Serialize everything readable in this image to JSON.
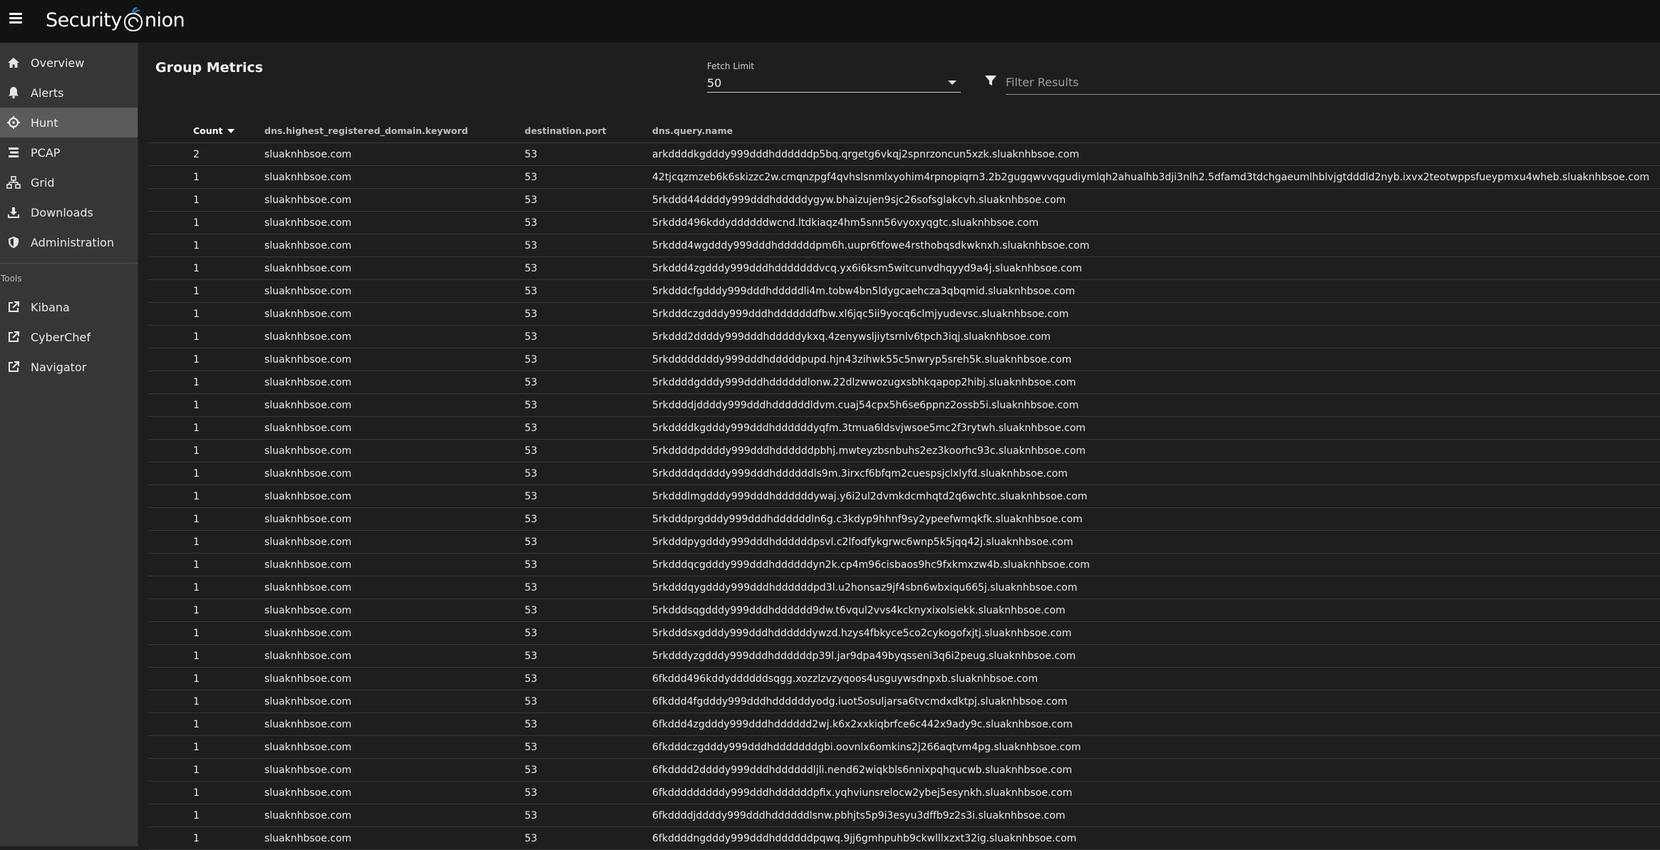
{
  "header": {
    "logo_text_left": "Security",
    "logo_text_right": "nion",
    "colors": {
      "topbar": "#121212",
      "logo_accent": "#2f86c7"
    }
  },
  "sidebar": {
    "items": [
      {
        "label": "Overview",
        "icon": "home-icon"
      },
      {
        "label": "Alerts",
        "icon": "bell-icon"
      },
      {
        "label": "Hunt",
        "icon": "crosshairs-icon",
        "active": true
      },
      {
        "label": "PCAP",
        "icon": "pcap-list-icon"
      },
      {
        "label": "Grid",
        "icon": "grid-network-icon"
      },
      {
        "label": "Downloads",
        "icon": "download-icon"
      },
      {
        "label": "Administration",
        "icon": "shield-icon"
      }
    ],
    "tools_heading": "Tools",
    "tools": [
      {
        "label": "Kibana",
        "icon": "external-link-icon"
      },
      {
        "label": "CyberChef",
        "icon": "external-link-icon"
      },
      {
        "label": "Navigator",
        "icon": "external-link-icon"
      }
    ]
  },
  "main": {
    "title": "Group Metrics",
    "fetch_limit": {
      "label": "Fetch Limit",
      "value": "50"
    },
    "filter": {
      "placeholder": "Filter Results",
      "value": ""
    },
    "table": {
      "columns": [
        "Count",
        "dns.highest_registered_domain.keyword",
        "destination.port",
        "dns.query.name"
      ],
      "rows": [
        [
          "2",
          "sluaknhbsoe.com",
          "53",
          "arkddddkgdddy999dddhddddddp5bq.qrgetg6vkqj2spnrzoncun5xzk.sluaknhbsoe.com"
        ],
        [
          "1",
          "sluaknhbsoe.com",
          "53",
          "42tjcqzmzeb6k6skizzc2w.cmqnzpgf4qvhslsnmlxyohim4rpnopiqrn3.2b2gugqwvvqgudiymlqh2ahualhb3dji3nlh2.5dfamd3tdchgaeumlhblvjgtdddld2nyb.ixvx2teotwppsfueypmxu4wheb.sluaknhbsoe.com"
        ],
        [
          "1",
          "sluaknhbsoe.com",
          "53",
          "5rkddd44ddddy999dddhdddddygyw.bhaizujen9sjc26sofsglakcvh.sluaknhbsoe.com"
        ],
        [
          "1",
          "sluaknhbsoe.com",
          "53",
          "5rkddd496kddyddddddwcnd.ltdkiaqz4hm5snn56vyoxyqgtc.sluaknhbsoe.com"
        ],
        [
          "1",
          "sluaknhbsoe.com",
          "53",
          "5rkddd4wgdddy999dddhddddddpm6h.uupr6tfowe4rsthobqsdkwknxh.sluaknhbsoe.com"
        ],
        [
          "1",
          "sluaknhbsoe.com",
          "53",
          "5rkddd4zgdddy999dddhdddddddvcq.yx6i6ksm5witcunvdhqyyd9a4j.sluaknhbsoe.com"
        ],
        [
          "1",
          "sluaknhbsoe.com",
          "53",
          "5rkdddcfgdddy999dddhdddddli4m.tobw4bn5ldygcaehcza3qbqmid.sluaknhbsoe.com"
        ],
        [
          "1",
          "sluaknhbsoe.com",
          "53",
          "5rkdddczgdddy999dddhdddddddfbw.xl6jqc5ii9yocq6clmjyudevsc.sluaknhbsoe.com"
        ],
        [
          "1",
          "sluaknhbsoe.com",
          "53",
          "5rkddd2ddddy999dddhdddddykxq.4zenywsljiytsrnlv6tpch3iqj.sluaknhbsoe.com"
        ],
        [
          "1",
          "sluaknhbsoe.com",
          "53",
          "5rkddddddddy999dddhdddddpupd.hjn43zihwk55c5nwryp5sreh5k.sluaknhbsoe.com"
        ],
        [
          "1",
          "sluaknhbsoe.com",
          "53",
          "5rkddddgdddy999dddhddddddlonw.22dlzwwozugxsbhkqapop2hibj.sluaknhbsoe.com"
        ],
        [
          "1",
          "sluaknhbsoe.com",
          "53",
          "5rkddddjddddy999dddhddddddldvm.cuaj54cpx5h6se6ppnz2ossb5i.sluaknhbsoe.com"
        ],
        [
          "1",
          "sluaknhbsoe.com",
          "53",
          "5rkddddkgdddy999dddhddddddyqfm.3tmua6ldsvjwsoe5mc2f3rytwh.sluaknhbsoe.com"
        ],
        [
          "1",
          "sluaknhbsoe.com",
          "53",
          "5rkddddpddddy999dddhddddddpbhj.mwteyzbsnbuhs2ez3koorhc93c.sluaknhbsoe.com"
        ],
        [
          "1",
          "sluaknhbsoe.com",
          "53",
          "5rkddddqddddy999dddhddddddls9m.3irxcf6bfqm2cuespsjclxlyfd.sluaknhbsoe.com"
        ],
        [
          "1",
          "sluaknhbsoe.com",
          "53",
          "5rkdddlmgdddy999dddhddddddywaj.y6i2ul2dvmkdcmhqtd2q6wchtc.sluaknhbsoe.com"
        ],
        [
          "1",
          "sluaknhbsoe.com",
          "53",
          "5rkdddprgdddy999dddhddddddln6g.c3kdyp9hhnf9sy2ypeefwmqkfk.sluaknhbsoe.com"
        ],
        [
          "1",
          "sluaknhbsoe.com",
          "53",
          "5rkdddpygdddy999dddhddddddpsvl.c2lfodfykgrwc6wnp5k5jqq42j.sluaknhbsoe.com"
        ],
        [
          "1",
          "sluaknhbsoe.com",
          "53",
          "5rkdddqcgdddy999dddhddddddyn2k.cp4m96cisbaos9hc9fxkmxzw4b.sluaknhbsoe.com"
        ],
        [
          "1",
          "sluaknhbsoe.com",
          "53",
          "5rkdddqygdddy999dddhddddddpd3l.u2honsaz9jf4sbn6wbxiqu665j.sluaknhbsoe.com"
        ],
        [
          "1",
          "sluaknhbsoe.com",
          "53",
          "5rkdddsqgdddy999dddhdddddd9dw.t6vqul2vvs4kcknyxixolsiekk.sluaknhbsoe.com"
        ],
        [
          "1",
          "sluaknhbsoe.com",
          "53",
          "5rkdddsxgdddy999dddhddddddywzd.hzys4fbkyce5co2cykogofxjtj.sluaknhbsoe.com"
        ],
        [
          "1",
          "sluaknhbsoe.com",
          "53",
          "5rkdddyzgdddy999dddhddddddp39l.jar9dpa49byqsseni3q6i2peug.sluaknhbsoe.com"
        ],
        [
          "1",
          "sluaknhbsoe.com",
          "53",
          "6fkddd496kddyddddddsqgg.xozzlzvzyqoos4usguywsdnpxb.sluaknhbsoe.com"
        ],
        [
          "1",
          "sluaknhbsoe.com",
          "53",
          "6fkddd4fgdddy999dddhddddddyodg.iuot5osuljarsa6tvcmdxdktpj.sluaknhbsoe.com"
        ],
        [
          "1",
          "sluaknhbsoe.com",
          "53",
          "6fkddd4zgdddy999dddhdddddd2wj.k6x2xxkiqbrfce6c442x9ady9c.sluaknhbsoe.com"
        ],
        [
          "1",
          "sluaknhbsoe.com",
          "53",
          "6fkdddczgdddy999dddhdddddddgbi.oovnlx6omkins2j266aqtvm4pg.sluaknhbsoe.com"
        ],
        [
          "1",
          "sluaknhbsoe.com",
          "53",
          "6fkdddd2ddddy999dddhddddddljli.nend62wiqkbls6nnixpqhqucwb.sluaknhbsoe.com"
        ],
        [
          "1",
          "sluaknhbsoe.com",
          "53",
          "6fkdddddddddy999dddhddddddpfix.yqhviunsrelocw2ybej5esynkh.sluaknhbsoe.com"
        ],
        [
          "1",
          "sluaknhbsoe.com",
          "53",
          "6fkddddjddddy999dddhddddddlsnw.pbhjts5p9i3esyu3dffb9z2s3i.sluaknhbsoe.com"
        ],
        [
          "1",
          "sluaknhbsoe.com",
          "53",
          "6fkddddngdddy999dddhddddddpqwq.9jj6gmhpuhb9ckwlllxzxt32ig.sluaknhbsoe.com"
        ]
      ]
    }
  }
}
